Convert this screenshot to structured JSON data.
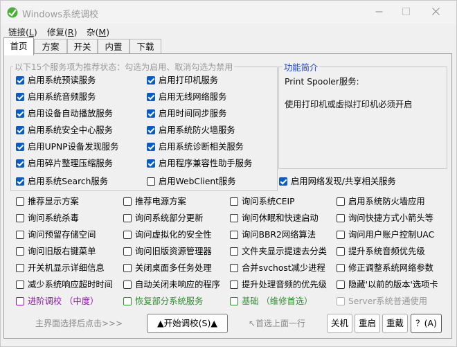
{
  "window": {
    "title": "Windows系统调校"
  },
  "menu": [
    {
      "label": "链接(L)",
      "text": "链接(",
      "key": "L",
      "tail": ")"
    },
    {
      "label": "修复(R)",
      "text": "修复(",
      "key": "R",
      "tail": ")"
    },
    {
      "label": "杂(M)",
      "text": "杂(",
      "key": "M",
      "tail": ")"
    }
  ],
  "tabs": [
    "首页",
    "方案",
    "开关",
    "内置",
    "下载"
  ],
  "services_group": {
    "title": "以下15个服务项为推荐状态：勾选为启用、取消勾选为禁用"
  },
  "services": [
    {
      "label": "启用系统预读服务",
      "checked": true
    },
    {
      "label": "启用打印机服务",
      "checked": true
    },
    {
      "label": "启用系统音频服务",
      "checked": true
    },
    {
      "label": "启用无线网络服务",
      "checked": true
    },
    {
      "label": "启用设备自动播放服务",
      "checked": true
    },
    {
      "label": "启用时间同步服务",
      "checked": true
    },
    {
      "label": "启用系统安全中心服务",
      "checked": true
    },
    {
      "label": "启用系统防火墙服务",
      "checked": true
    },
    {
      "label": "启用UPNP设备发现服务",
      "checked": true
    },
    {
      "label": "启用系统诊断相关服务",
      "checked": true
    },
    {
      "label": "启用碎片整理压缩服务",
      "checked": true
    },
    {
      "label": "启用程序兼容性助手服务",
      "checked": true
    },
    {
      "label": "启用系统Search服务",
      "checked": true
    },
    {
      "label": "启用WebClient服务",
      "checked": false
    },
    {
      "label": "启用网络发现/共享相关服务",
      "checked": true
    }
  ],
  "intro": {
    "title": "功能简介",
    "line1": "Print Spooler服务:",
    "line2": "使用打印机或虚拟打印机必须开启"
  },
  "options": [
    [
      "推荐显示方案",
      "推荐电源方案",
      "询问系统CEIP",
      "启用系统防火墙应用"
    ],
    [
      "询问系统杀毒",
      "询问系统部分更新",
      "询问休眠和快速启动",
      "询问快捷方式小箭头等"
    ],
    [
      "询问预留存储空间",
      "询问虚拟化的安全性",
      "询问BBR2网络算法",
      "询问用户账户控制UAC"
    ],
    [
      "询问旧版右键菜单",
      "询问旧版资源管理器",
      "文件夹显示提速去分类",
      "提升系统音频优先级"
    ],
    [
      "开关机显示详细信息",
      "关闭桌面多任务处理",
      "合并svchost减少进程",
      "修正调整系统网络参数"
    ],
    [
      "减少系统响应超时时间",
      "自动关闭未响应的程序",
      "提升处理音频的优先级",
      "隐藏'以前的版本'选项卡"
    ]
  ],
  "modes": [
    {
      "label": "进阶调校 （中度）",
      "color": "#8b1aa6"
    },
    {
      "label": "恢复部分系统服务",
      "color": "#2f8f2f"
    },
    {
      "label": "基础 （维修首选）",
      "color": "#2f8f2f"
    },
    {
      "label": "Server系统普通使用",
      "color": "#9a9a9a"
    }
  ],
  "footer": {
    "hint_left": "主界面选择后点击>>>",
    "start": "▲开始调校(S)▲",
    "hint_right": "↖首选上面一行",
    "shutdown": "关机",
    "restart": "重启",
    "reboot": "重戴",
    "help": "？(A)"
  },
  "colors": {
    "accent": "#0a5bc4",
    "intro_title": "#1a3fd0"
  }
}
